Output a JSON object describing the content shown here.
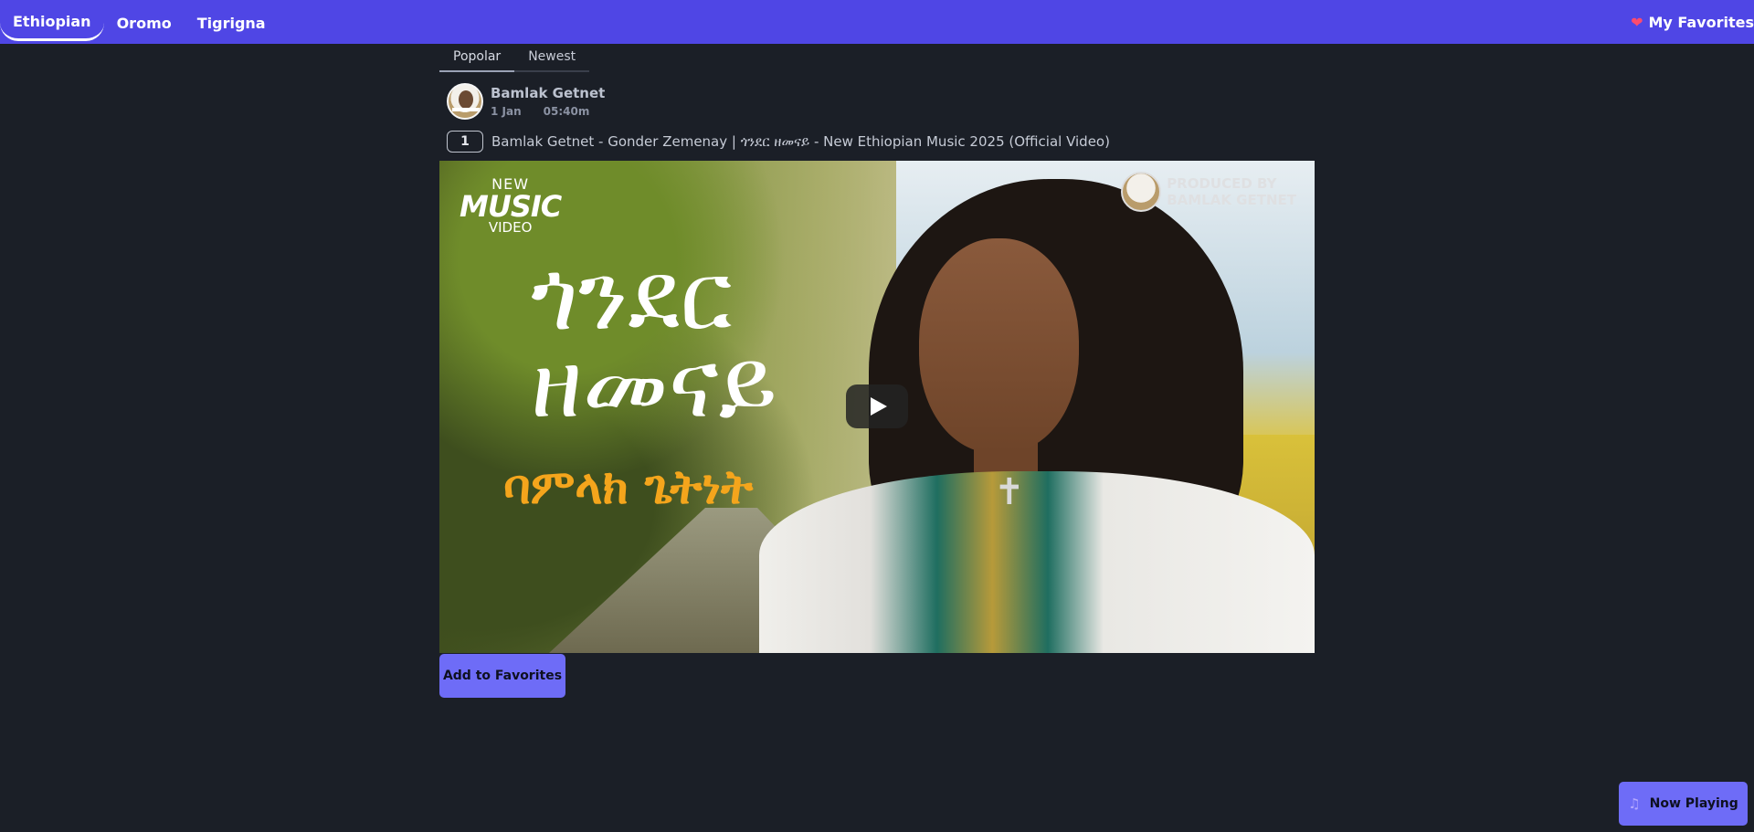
{
  "nav": {
    "tabs": [
      {
        "label": "Ethiopian",
        "active": true
      },
      {
        "label": "Oromo",
        "active": false
      },
      {
        "label": "Tigrigna",
        "active": false
      }
    ],
    "favorites_label": "My Favorites",
    "favorites_icon": "heart-icon"
  },
  "subtabs": [
    {
      "label": "Popolar",
      "active": true
    },
    {
      "label": "Newest",
      "active": false
    }
  ],
  "post": {
    "author": "Bamlak Getnet",
    "date": "1 Jan",
    "duration": "05:40m",
    "rank": "1",
    "title": "Bamlak Getnet - Gonder Zemenay | ጎንደር ዘመናይ - New Ethiopian Music 2025 (Official Video)"
  },
  "thumbnail": {
    "badge_line1": "NEW",
    "badge_line2": "MUSIC",
    "badge_line3": "VIDEO",
    "amharic_title_1": "ጎንደር",
    "amharic_title_2": "ዘመናይ",
    "amharic_subtitle": "ባምላክ ጌትነት",
    "produced_line1": "PRODUCED BY",
    "produced_line2": "BAMLAK GETNET"
  },
  "actions": {
    "add_favorites": "Add to Favorites",
    "now_playing": "Now Playing",
    "now_playing_icon": "music-note-icon"
  },
  "colors": {
    "accent": "#4f46e5",
    "button": "#6e6cf7",
    "background": "#1b1f27"
  }
}
